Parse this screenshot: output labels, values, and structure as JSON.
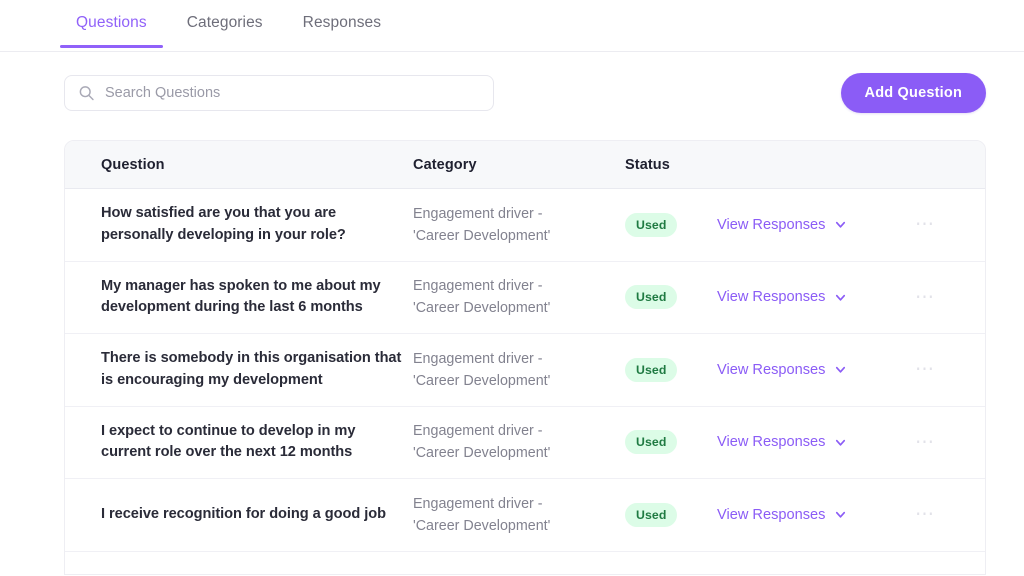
{
  "tabs": [
    {
      "label": "Questions",
      "active": true
    },
    {
      "label": "Categories",
      "active": false
    },
    {
      "label": "Responses",
      "active": false
    }
  ],
  "toolbar": {
    "search_placeholder": "Search Questions",
    "search_value": "",
    "search_icon": "search-icon",
    "add_button_label": "Add Question"
  },
  "table": {
    "columns": [
      "Question",
      "Category",
      "Status"
    ],
    "rows": [
      {
        "question": "How satisfied are you that you are personally developing in your role?",
        "category_line1": "Engagement driver -",
        "category_line2": "'Career Development'",
        "status": "Used",
        "action": "View Responses",
        "more": "⋯"
      },
      {
        "question": "My manager has spoken to me about my development during the last 6 months",
        "category_line1": "Engagement driver -",
        "category_line2": "'Career Development'",
        "status": "Used",
        "action": "View Responses",
        "more": "⋯"
      },
      {
        "question": "There is somebody in this organisation that is encouraging my development",
        "category_line1": "Engagement driver -",
        "category_line2": "'Career Development'",
        "status": "Used",
        "action": "View Responses",
        "more": "⋯"
      },
      {
        "question": "I expect to continue to develop in my current role over the next 12 months",
        "category_line1": "Engagement driver -",
        "category_line2": "'Career Development'",
        "status": "Used",
        "action": "View Responses",
        "more": "⋯"
      },
      {
        "question": "I receive recognition for doing a good job",
        "category_line1": "Engagement driver -",
        "category_line2": "'Career Development'",
        "status": "Used",
        "action": "View Responses",
        "more": "⋯"
      }
    ]
  },
  "colors": {
    "accent_purple": "#8b5cf6",
    "tab_active": "#9061f9",
    "badge_bg": "#dcfce7",
    "badge_text": "#1f7a42",
    "header_bg": "#f7f8fa",
    "muted_text": "#82828f"
  }
}
